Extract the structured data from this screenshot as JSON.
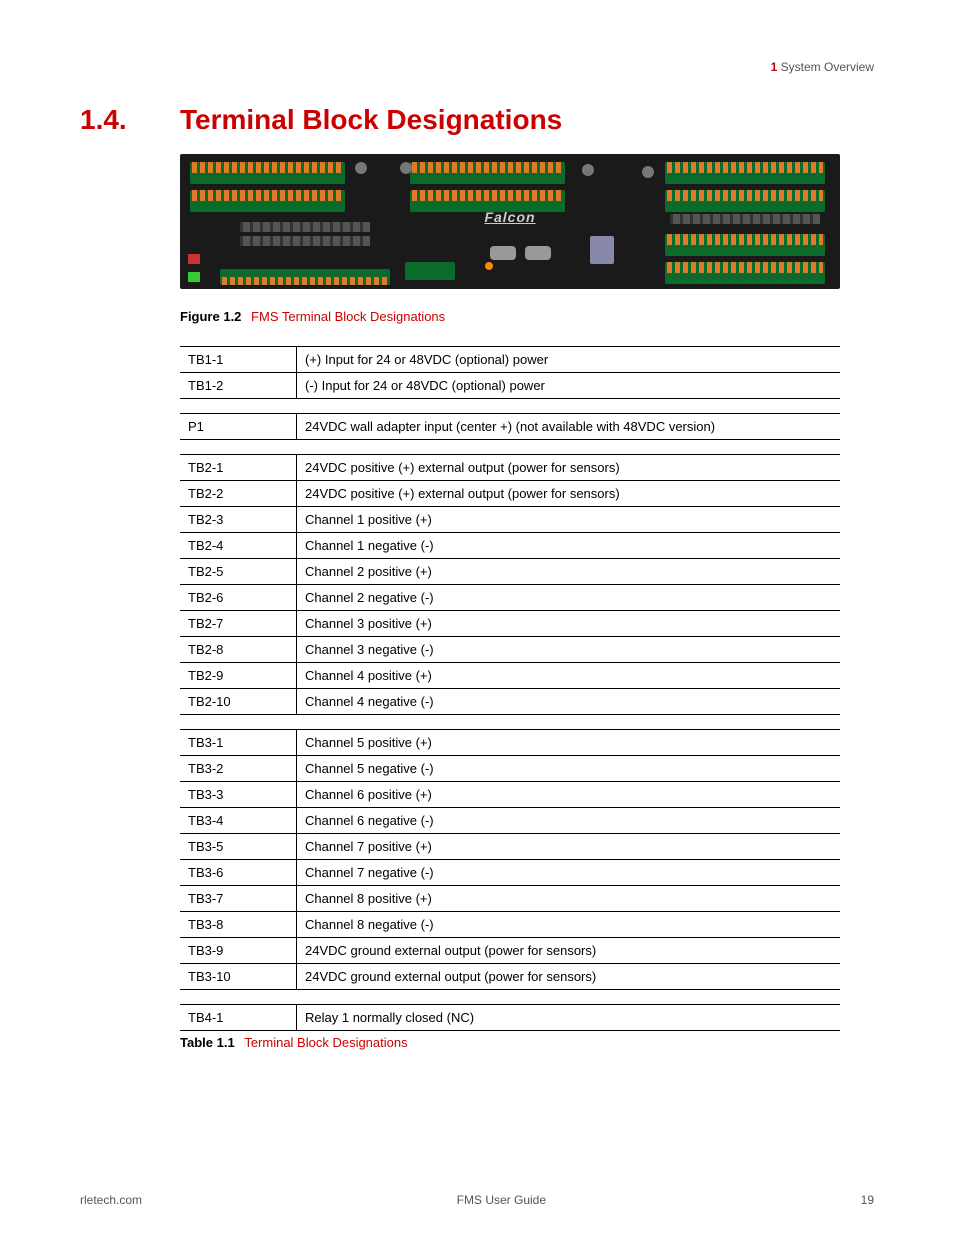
{
  "header": {
    "chapter_num": "1",
    "chapter_title": "System Overview"
  },
  "section": {
    "number": "1.4.",
    "title": "Terminal Block Designations"
  },
  "figure": {
    "brand": "Falcon",
    "label": "Figure 1.2",
    "caption": "FMS Terminal Block Designations"
  },
  "tables": {
    "tb1": [
      {
        "pin": "TB1-1",
        "desc": "(+) Input for 24 or 48VDC (optional) power"
      },
      {
        "pin": "TB1-2",
        "desc": "(-) Input for 24 or 48VDC (optional) power"
      }
    ],
    "p1": [
      {
        "pin": "P1",
        "desc": "24VDC wall adapter input (center +) (not available with 48VDC version)"
      }
    ],
    "tb2": [
      {
        "pin": "TB2-1",
        "desc": "24VDC positive (+) external output (power for sensors)"
      },
      {
        "pin": "TB2-2",
        "desc": "24VDC positive (+) external output (power for sensors)"
      },
      {
        "pin": "TB2-3",
        "desc": "Channel 1 positive (+)"
      },
      {
        "pin": "TB2-4",
        "desc": "Channel 1 negative (-)"
      },
      {
        "pin": "TB2-5",
        "desc": "Channel 2 positive (+)"
      },
      {
        "pin": "TB2-6",
        "desc": "Channel 2 negative (-)"
      },
      {
        "pin": "TB2-7",
        "desc": "Channel 3 positive (+)"
      },
      {
        "pin": "TB2-8",
        "desc": "Channel 3 negative (-)"
      },
      {
        "pin": "TB2-9",
        "desc": "Channel 4 positive (+)"
      },
      {
        "pin": "TB2-10",
        "desc": "Channel 4 negative (-)"
      }
    ],
    "tb3": [
      {
        "pin": "TB3-1",
        "desc": "Channel 5 positive (+)"
      },
      {
        "pin": "TB3-2",
        "desc": "Channel 5 negative (-)"
      },
      {
        "pin": "TB3-3",
        "desc": "Channel 6 positive (+)"
      },
      {
        "pin": "TB3-4",
        "desc": "Channel 6 negative (-)"
      },
      {
        "pin": "TB3-5",
        "desc": "Channel 7 positive (+)"
      },
      {
        "pin": "TB3-6",
        "desc": "Channel 7 negative (-)"
      },
      {
        "pin": "TB3-7",
        "desc": "Channel 8 positive (+)"
      },
      {
        "pin": "TB3-8",
        "desc": "Channel 8 negative (-)"
      },
      {
        "pin": "TB3-9",
        "desc": "24VDC ground external output (power for sensors)"
      },
      {
        "pin": "TB3-10",
        "desc": "24VDC ground external output (power for sensors)"
      }
    ],
    "tb4": [
      {
        "pin": "TB4-1",
        "desc": "Relay 1 normally closed (NC)"
      }
    ]
  },
  "table_caption": {
    "label": "Table 1.1",
    "title": "Terminal Block Designations"
  },
  "footer": {
    "left": "rletech.com",
    "center": "FMS User Guide",
    "right": "19"
  }
}
